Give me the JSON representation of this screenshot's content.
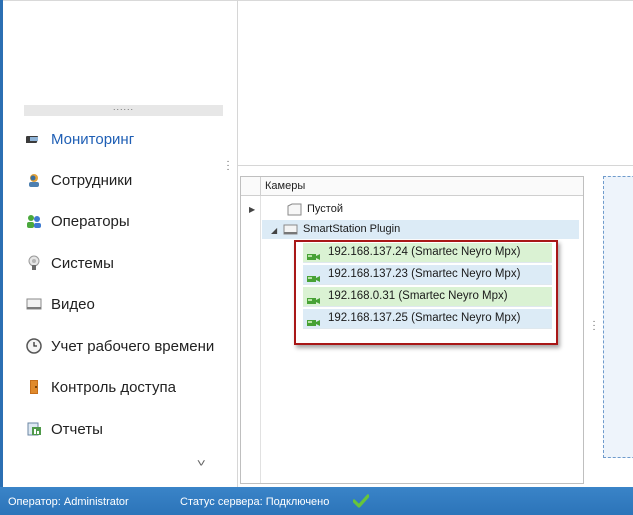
{
  "sidebar": {
    "splitter_dots": "......",
    "items": [
      {
        "label": "Мониторинг",
        "icon": "monitor-icon",
        "active": true
      },
      {
        "label": "Сотрудники",
        "icon": "employees-icon"
      },
      {
        "label": "Операторы",
        "icon": "operators-icon"
      },
      {
        "label": "Системы",
        "icon": "systems-icon"
      },
      {
        "label": "Видео",
        "icon": "video-icon"
      },
      {
        "label": "Учет рабочего времени",
        "icon": "clock-icon"
      },
      {
        "label": "Контроль доступа",
        "icon": "door-icon"
      },
      {
        "label": "Отчеты",
        "icon": "reports-icon"
      }
    ],
    "expand_glyph": "˅"
  },
  "tree": {
    "header": "Камеры",
    "nodes": [
      {
        "label": "Пустой",
        "expanded": false
      },
      {
        "label": "SmartStation Plugin",
        "expanded": true
      }
    ],
    "cameras": [
      {
        "label": "192.168.137.24 (Smartec Neyro Mpx)",
        "color": "#daf2d3"
      },
      {
        "label": "192.168.137.23 (Smartec Neyro Mpx)",
        "color": "#dcebf6"
      },
      {
        "label": "192.168.0.31 (Smartec Neyro Mpx)",
        "color": "#daf2d3"
      },
      {
        "label": "192.168.137.25 (Smartec Neyro Mpx)",
        "color": "#dcebf6"
      }
    ]
  },
  "statusbar": {
    "operator": "Оператор: Administrator",
    "server_status": "Статус сервера: Подключено"
  },
  "colors": {
    "accent": "#2b6fb3",
    "selection_border": "#a81717",
    "status_ok": "#5fbf2a"
  }
}
